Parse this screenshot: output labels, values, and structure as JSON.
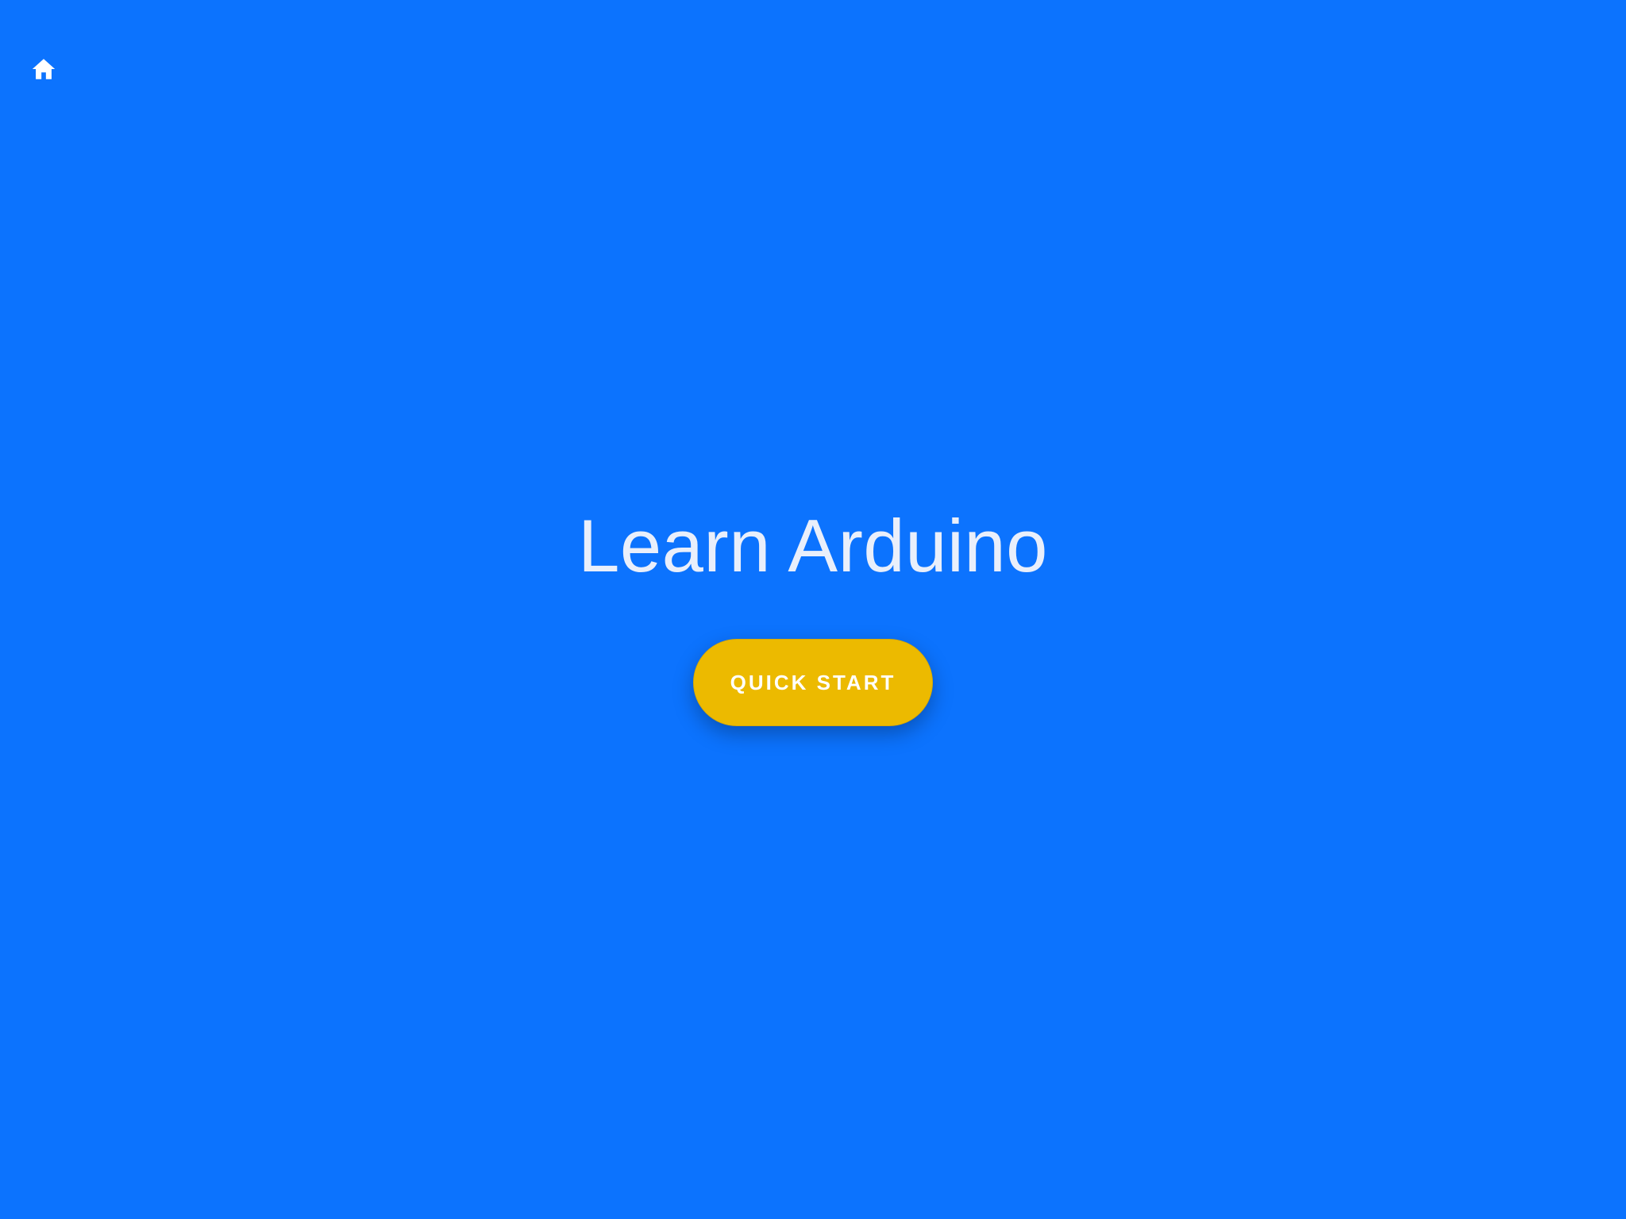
{
  "colors": {
    "background": "#0c73fe",
    "accent_button": "#ecba00",
    "title_text": "#e9effb",
    "button_text": "#ffffff"
  },
  "nav": {
    "home_icon": "home-icon"
  },
  "hero": {
    "title": "Learn Arduino",
    "cta_label": "QUICK START"
  }
}
